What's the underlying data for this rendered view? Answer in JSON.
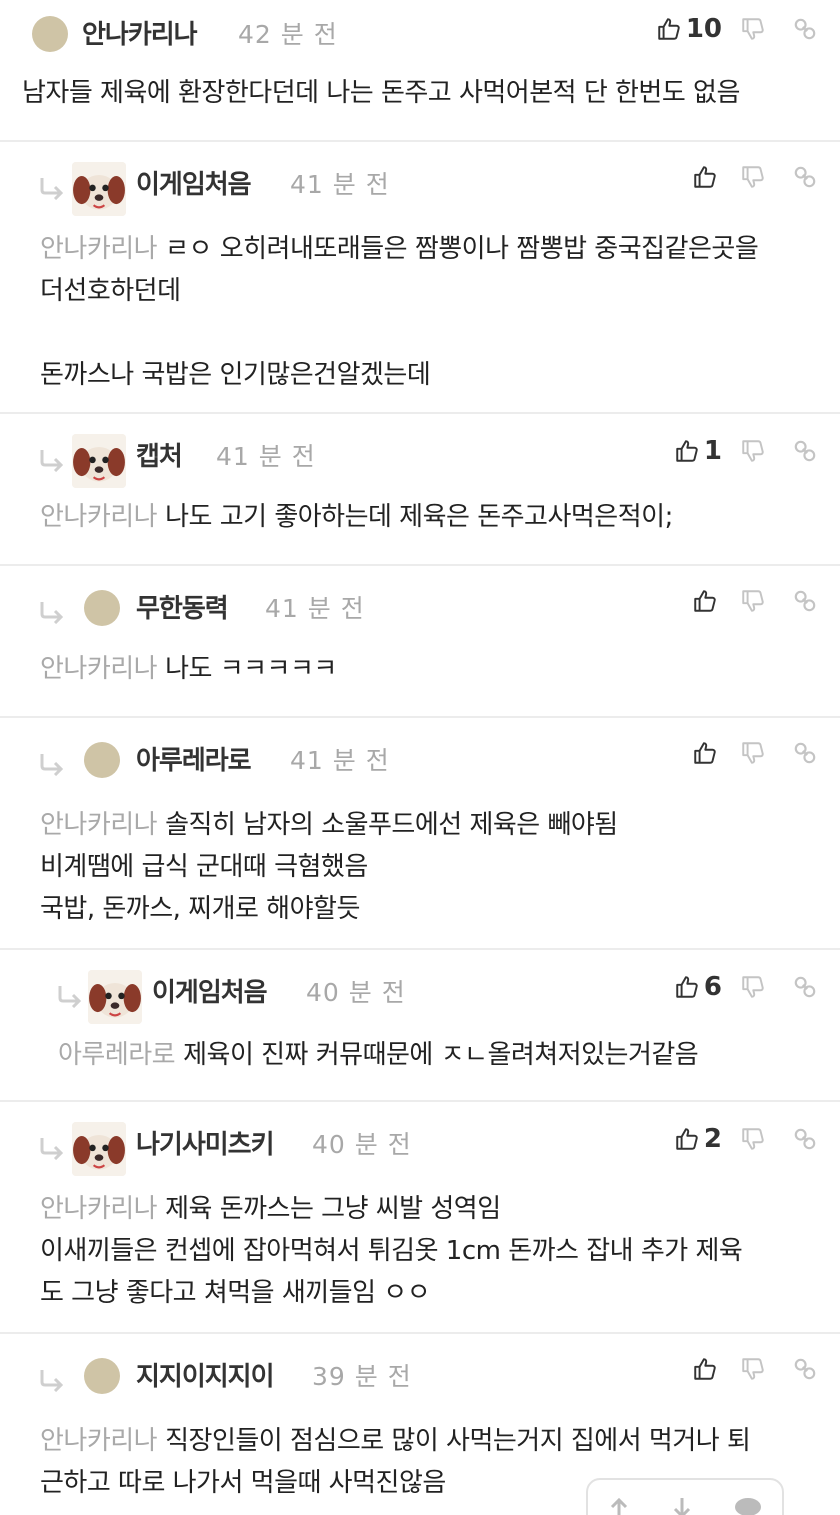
{
  "time_unit": "분 전",
  "comments": [
    {
      "name": "안나카리나",
      "minutes": "42",
      "likes": "10",
      "mention": "",
      "text": "남자들 제육에 환장한다던데 나는 돈주고 사먹어본적 단 한번도 없음"
    },
    {
      "name": "이게임처음",
      "minutes": "41",
      "likes": "",
      "mention": "안나카리나",
      "text": "ㄹㅇ 오히려내또래들은 짬뽕이나 짬뽕밥 중국집같은곳을\n더선호하던데\n\n돈까스나 국밥은 인기많은건알겠는데"
    },
    {
      "name": "캡처",
      "minutes": "41",
      "likes": "1",
      "mention": "안나카리나",
      "text": "나도 고기 좋아하는데 제육은 돈주고사먹은적이;"
    },
    {
      "name": "무한동력",
      "minutes": "41",
      "likes": "",
      "mention": "안나카리나",
      "text": "나도 ㅋㅋㅋㅋㅋ"
    },
    {
      "name": "아루레라로",
      "minutes": "41",
      "likes": "",
      "mention": "안나카리나",
      "text": "솔직히 남자의 소울푸드에선 제육은 빼야됨\n비계땜에 급식 군대때 극혐했음\n국밥, 돈까스, 찌개로 해야할듯"
    },
    {
      "name": "이게임처음",
      "minutes": "40",
      "likes": "6",
      "mention": "아루레라로",
      "text": "제육이 진짜 커뮤때문에 ㅈㄴ올려쳐저있는거같음"
    },
    {
      "name": "나기사미츠키",
      "minutes": "40",
      "likes": "2",
      "mention": "안나카리나",
      "text": "제육 돈까스는 그냥 씨발 성역임\n이새끼들은 컨셉에 잡아먹혀서 튀김옷 1cm 돈까스 잡내 추가 제육\n도 그냥 좋다고 쳐먹을 새끼들임 ㅇㅇ"
    },
    {
      "name": "지지이지지이",
      "minutes": "39",
      "likes": "",
      "mention": "안나카리나",
      "text": "직장인들이 점심으로 많이 사먹는거지 집에서 먹거나 퇴\n근하고 따로 나가서 먹을때 사먹진않음"
    }
  ]
}
